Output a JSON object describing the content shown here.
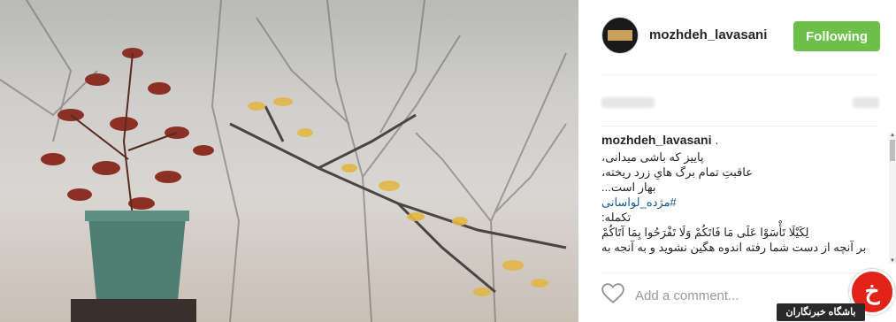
{
  "post": {
    "username": "mozhdeh_lavasani",
    "follow_label": "Following",
    "caption_user": "mozhdeh_lavasani",
    "caption_user_suffix": " .",
    "caption_lines": [
      "پاییز که باشی میدانی،",
      "عاقبتِ تمام برگ هایِ زرد ریخته،",
      "بهار است...",
      "#مژده_لواسانی",
      "تکمله:",
      "لِکَيْلَا تَأْسَوْا عَلَى مَا فَاتَكُمْ وَلَا تَفْرَحُوا بِمَا آتَاكُمْ",
      "بر آنچه از دست شما رفته اندوه هگین نشوید و به آنجه به"
    ],
    "comment_placeholder": "Add a comment..."
  },
  "badge": {
    "logo_glyph": "خ",
    "label": "باشگاه خبرنگاران"
  },
  "colors": {
    "follow_button": "#6cc04a",
    "hashtag": "#125688",
    "badge_red": "#e2231a"
  },
  "icons": [
    "heart-icon",
    "avatar",
    "scroll-up-arrow",
    "scroll-down-arrow"
  ]
}
